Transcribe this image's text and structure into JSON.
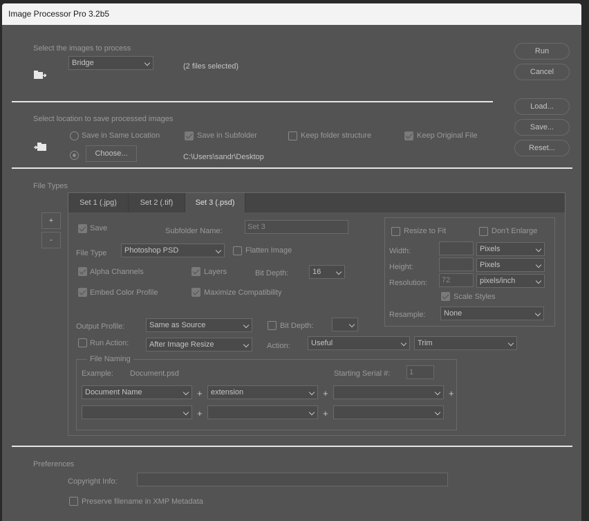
{
  "window": {
    "title": "Image Processor Pro 3.2b5"
  },
  "source": {
    "label": "Select the images to process",
    "dropdown": "Bridge",
    "files_selected": "(2 files selected)"
  },
  "actions": {
    "run": "Run",
    "cancel": "Cancel",
    "load": "Load...",
    "save": "Save...",
    "reset": "Reset..."
  },
  "location": {
    "label": "Select location to save processed images",
    "same_location": "Save in Same Location",
    "choose": "Choose...",
    "save_subfolder": "Save in Subfolder",
    "keep_structure": "Keep folder structure",
    "keep_original": "Keep Original File",
    "path": "C:\\Users\\sandr\\Desktop"
  },
  "file_types": {
    "label": "File Types",
    "add": "+",
    "remove": "-",
    "tabs": [
      "Set 1 (.jpg)",
      "Set 2 (.tif)",
      "Set 3 (.psd)"
    ],
    "active_tab": 2,
    "save_label": "Save",
    "subfolder_label": "Subfolder Name:",
    "subfolder_value": "Set 3",
    "file_type_label": "File Type",
    "file_type_value": "Photoshop PSD",
    "flatten": "Flatten Image",
    "alpha": "Alpha Channels",
    "layers": "Layers",
    "bit_depth_label": "Bit Depth:",
    "bit_depth_value": "16",
    "embed_profile": "Embed Color Profile",
    "max_compat": "Maximize Compatibility",
    "resize": {
      "resize_to_fit": "Resize to Fit",
      "dont_enlarge": "Don't Enlarge",
      "width_label": "Width:",
      "width_unit": "Pixels",
      "height_label": "Height:",
      "height_unit": "Pixels",
      "resolution_label": "Resolution:",
      "resolution_value": "72",
      "resolution_unit": "pixels/inch",
      "scale_styles": "Scale Styles",
      "resample_label": "Resample:",
      "resample_value": "None"
    },
    "output_profile_label": "Output Profile:",
    "output_profile_value": "Same as Source",
    "bit_depth2_label": "Bit Depth:",
    "run_action": "Run Action:",
    "run_action_value": "After Image Resize",
    "action_label": "Action:",
    "action_set": "Useful",
    "action_name": "Trim",
    "naming": {
      "legend": "File Naming",
      "example_label": "Example:",
      "example_value": "Document.psd",
      "serial_label": "Starting Serial #:",
      "serial_value": "1",
      "fields": [
        "Document Name",
        "extension",
        "",
        "",
        "",
        ""
      ],
      "plus": "+"
    }
  },
  "preferences": {
    "label": "Preferences",
    "copyright_label": "Copyright Info:",
    "copyright_value": "",
    "preserve_xmp": "Preserve filename in XMP Metadata"
  }
}
